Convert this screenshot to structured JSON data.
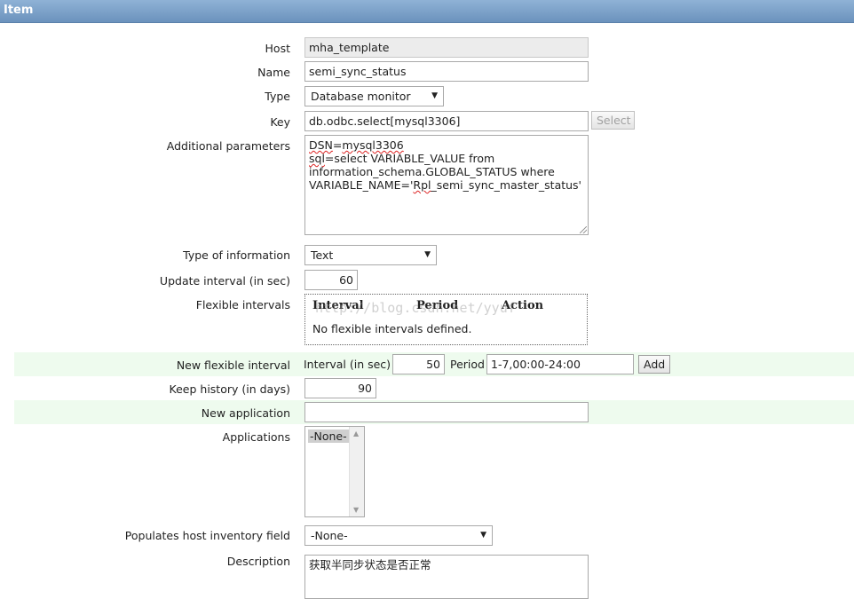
{
  "header": {
    "title": "Item"
  },
  "form": {
    "host": {
      "label": "Host",
      "value": "mha_template"
    },
    "name": {
      "label": "Name",
      "value": "semi_sync_status"
    },
    "type": {
      "label": "Type",
      "value": "Database monitor"
    },
    "key": {
      "label": "Key",
      "value": "db.odbc.select[mysql3306]",
      "button": "Select"
    },
    "params": {
      "label": "Additional parameters",
      "line1_a": "DSN",
      "line1_b": "=",
      "line1_c": "mysql3306",
      "line2_a": "sql",
      "line2_b": "=select VARIABLE_VALUE from",
      "line3": "information_schema.GLOBAL_STATUS where",
      "line4_a": "VARIABLE_NAME='",
      "line4_b": "Rpl",
      "line4_c": "_semi_sync_master_status'"
    },
    "type_of_info": {
      "label": "Type of information",
      "value": "Text"
    },
    "update_interval": {
      "label": "Update interval (in sec)",
      "value": "60"
    },
    "flexible": {
      "label": "Flexible intervals",
      "columns": [
        "Interval",
        "Period",
        "Action"
      ],
      "empty": "No flexible intervals defined.",
      "watermark": "http://blog.csdn.net/yyuf"
    },
    "new_flexible": {
      "label": "New flexible interval",
      "interval_label": "Interval (in sec)",
      "interval_value": "50",
      "period_label": "Period",
      "period_value": "1-7,00:00-24:00",
      "add": "Add"
    },
    "keep_history": {
      "label": "Keep history (in days)",
      "value": "90"
    },
    "new_application": {
      "label": "New application",
      "value": ""
    },
    "applications": {
      "label": "Applications",
      "options": [
        "-None-"
      ]
    },
    "inventory": {
      "label": "Populates host inventory field",
      "value": "-None-"
    },
    "description": {
      "label": "Description",
      "value": "获取半同步状态是否正常"
    }
  },
  "colors": {
    "header": "#7ea3cb",
    "highlight_row": "#eefbee"
  }
}
